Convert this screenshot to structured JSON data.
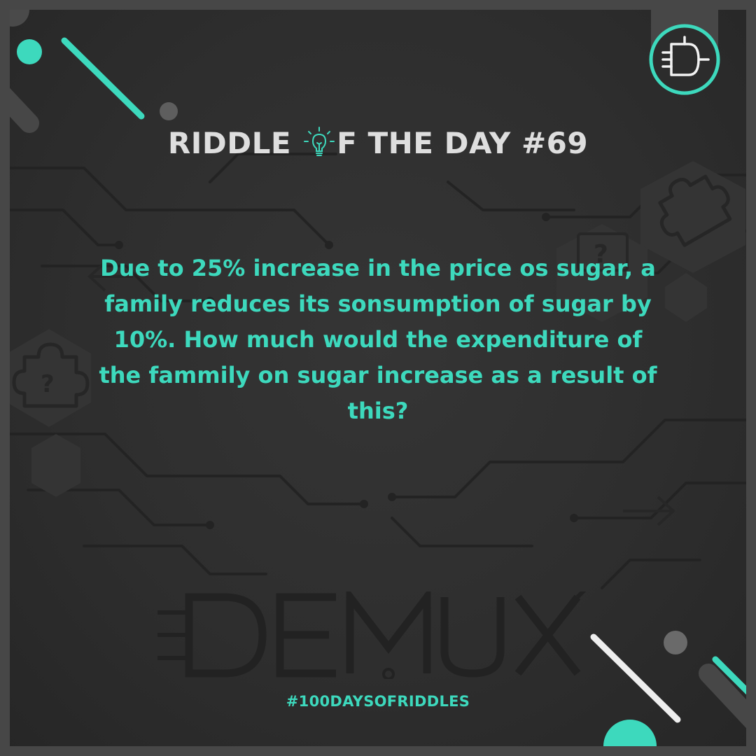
{
  "post": {
    "title_prefix": "RIDDLE ",
    "title_suffix": "F THE DAY #69",
    "question": "Due to 25% increase in the price os sugar, a family reduces its sonsumption of sugar by 10%. How much would the expenditure of the fammily on sugar increase as a result of this?",
    "hashtag": "#100DAYSOFRIDDLES",
    "watermark_brand": "DEMUX"
  },
  "icons": {
    "title_bulb": "lightbulb-icon",
    "logo": "demux-gate-logo-icon",
    "puzzle": "puzzle-piece-icon",
    "question_mark": "question-mark-icon"
  },
  "colors": {
    "accent": "#3dd9bd",
    "title": "#dedede",
    "background": "#2e2e2e",
    "frame": "#474747"
  }
}
